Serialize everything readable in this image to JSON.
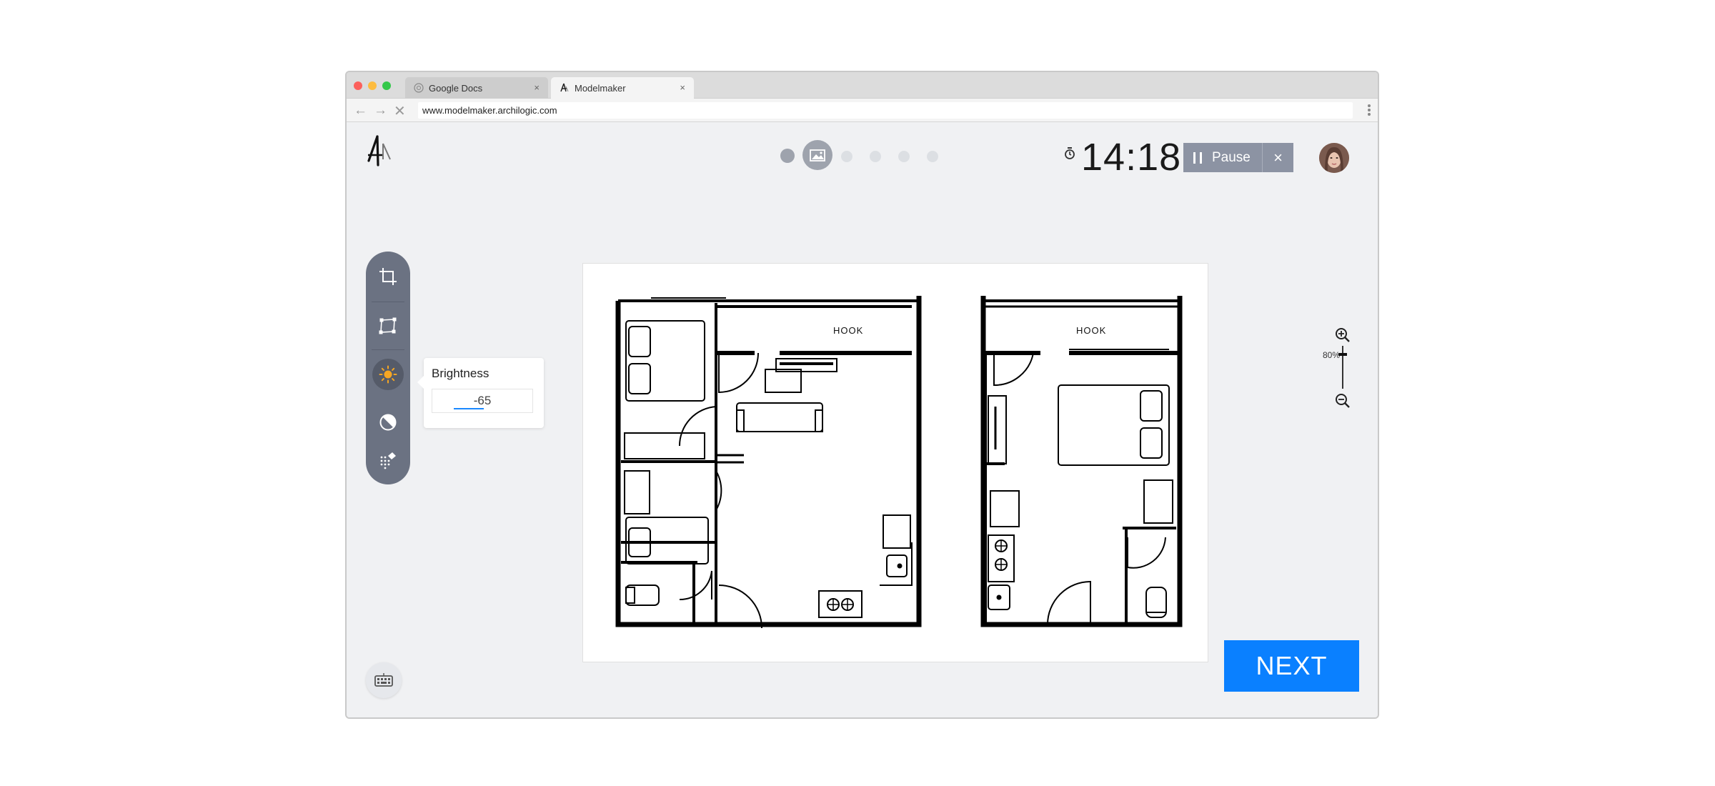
{
  "browser": {
    "tabs": [
      {
        "label": "Google Docs",
        "icon": "google-docs-favicon"
      },
      {
        "label": "Modelmaker",
        "icon": "archilogic-favicon"
      }
    ],
    "url": "www.modelmaker.archilogic.com",
    "tab_close": "×"
  },
  "app": {
    "logo": "archilogic-logo",
    "progress": {
      "total_steps": 6,
      "current_step": 2
    },
    "timer": "14:18",
    "pause_label": "Pause",
    "stop_icon": "×",
    "tools": [
      "crop-icon",
      "perspective-icon",
      "brightness-icon",
      "contrast-icon",
      "enhance-icon"
    ],
    "brightness": {
      "title": "Brightness",
      "value": "-65"
    },
    "floorplan": {
      "left_label": "HOOK",
      "right_label": "HOOK"
    },
    "zoom": {
      "level": "80%"
    },
    "next_label": "NEXT"
  },
  "colors": {
    "accent": "#0a80ff",
    "toolbar": "#6b7282",
    "pause_button": "#8c93a3",
    "brightness_active": "#f5a623"
  }
}
